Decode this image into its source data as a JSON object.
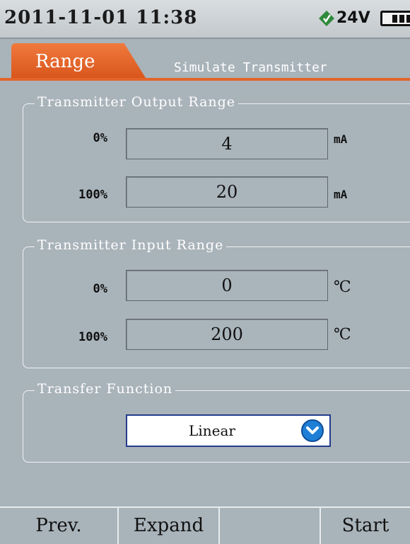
{
  "status": {
    "datetime": "2011-11-01 11:38",
    "voltage": "24V",
    "icons": [
      "power-status-icon",
      "battery-icon"
    ]
  },
  "tabs": {
    "active": "Range",
    "inactive": "Simulate Transmitter"
  },
  "output_range": {
    "title": "Transmitter Output Range",
    "rows": [
      {
        "label": "0%",
        "value": "4",
        "unit": "mA"
      },
      {
        "label": "100%",
        "value": "20",
        "unit": "mA"
      }
    ]
  },
  "input_range": {
    "title": "Transmitter Input Range",
    "rows": [
      {
        "label": "0%",
        "value": "0",
        "unit": "℃"
      },
      {
        "label": "100%",
        "value": "200",
        "unit": "℃"
      }
    ]
  },
  "transfer": {
    "title": "Transfer Function",
    "selected": "Linear"
  },
  "softkeys": [
    "Prev.",
    "Expand",
    "",
    "Start"
  ],
  "colors": {
    "accent": "#e2652a",
    "background": "#a9b3ba",
    "dropdown": "#1f7fd6"
  }
}
